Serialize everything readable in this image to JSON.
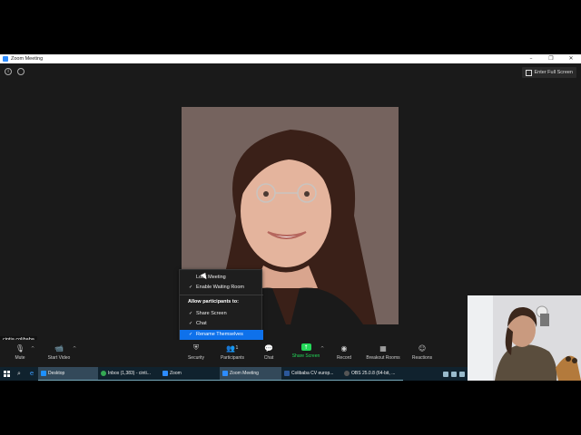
{
  "window": {
    "title": "Zoom Meeting",
    "controls": [
      "–",
      "❐",
      "✕"
    ]
  },
  "top_bar": {
    "fullscreen_label": "Enter Full Screen"
  },
  "participant_name": "cintia colibaba",
  "security_menu": {
    "lock_meeting": "Lock Meeting",
    "enable_waiting_room": "Enable Waiting Room",
    "allow_heading": "Allow participants to:",
    "share_screen": "Share Screen",
    "chat": "Chat",
    "rename_themselves": "Rename Themselves",
    "check": "✓"
  },
  "toolbar": {
    "mute": "Mute",
    "start_video": "Start Video",
    "security": "Security",
    "participants": "Participants",
    "participants_count": "1",
    "chat": "Chat",
    "share_screen": "Share Screen",
    "record": "Record",
    "breakout_rooms": "Breakout Rooms",
    "reactions": "Reactions",
    "caret": "^"
  },
  "taskbar": {
    "apps": [
      {
        "label": "Desktop",
        "color": "#1e90ff"
      },
      {
        "label": "Inbox (1,383) - cinti...",
        "color": "#34a853"
      },
      {
        "label": "Zoom",
        "color": "#2d8cff"
      },
      {
        "label": "Zoom Meeting",
        "color": "#2d8cff"
      },
      {
        "label": "Colibaba CV europ...",
        "color": "#2b579a"
      },
      {
        "label": "OBS 25.0.8 (64-bit, ...",
        "color": "#555555"
      }
    ]
  },
  "colors": {
    "accent": "#0e71eb",
    "share_green": "#23d959",
    "taskbar": "#10222e"
  }
}
